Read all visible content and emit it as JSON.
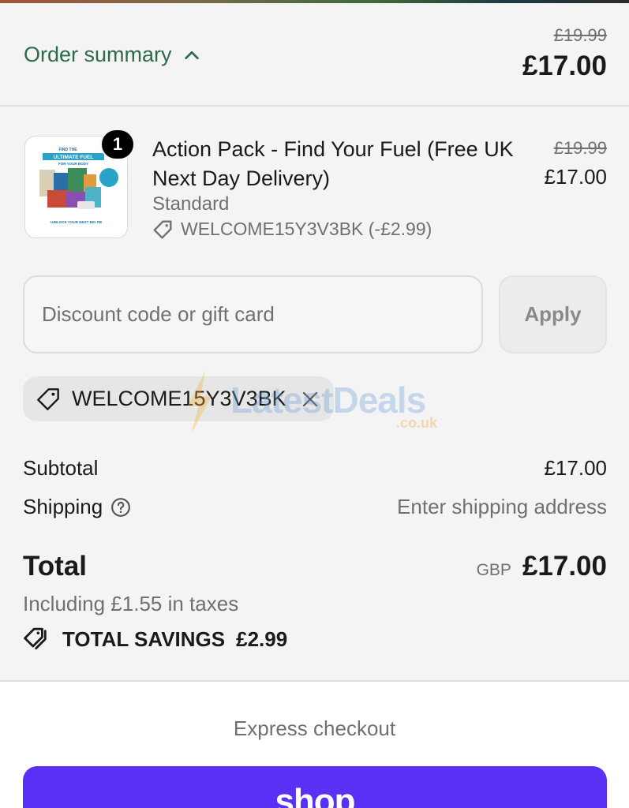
{
  "header": {
    "summary_label": "Order summary",
    "original_price": "£19.99",
    "price": "£17.00"
  },
  "product": {
    "quantity": "1",
    "title": "Action Pack - Find Your Fuel (Free UK Next Day Delivery)",
    "variant": "Standard",
    "discount_line": "WELCOME15Y3V3BK (-£2.99)",
    "original_price": "£19.99",
    "price": "£17.00",
    "thumbnail": {
      "top_text": "FIND THE",
      "banner_text": "ULTIMATE FUEL",
      "sub_text": "FOR YOUR BODY",
      "bottom_text": "+UNLOCK YOUR NEXT BIG PB"
    }
  },
  "discount": {
    "placeholder": "Discount code or gift card",
    "apply_label": "Apply",
    "applied_code": "WELCOME15Y3V3BK"
  },
  "watermark": {
    "text": "LatestDeals",
    "sub": ".co.uk"
  },
  "totals": {
    "subtotal_label": "Subtotal",
    "subtotal_value": "£17.00",
    "shipping_label": "Shipping",
    "shipping_value": "Enter shipping address",
    "total_label": "Total",
    "currency": "GBP",
    "total_value": "£17.00",
    "taxes_note": "Including £1.55 in taxes",
    "savings_label": "TOTAL SAVINGS",
    "savings_value": "£2.99"
  },
  "checkout": {
    "express_label": "Express checkout",
    "shop_pay_label": "shop"
  },
  "colors": {
    "accent_green": "#2e6a4a",
    "shop_purple": "#5a31f4"
  },
  "icons": [
    "chevron-up-icon",
    "tag-icon",
    "close-icon",
    "help-circle-icon",
    "tags-icon"
  ]
}
